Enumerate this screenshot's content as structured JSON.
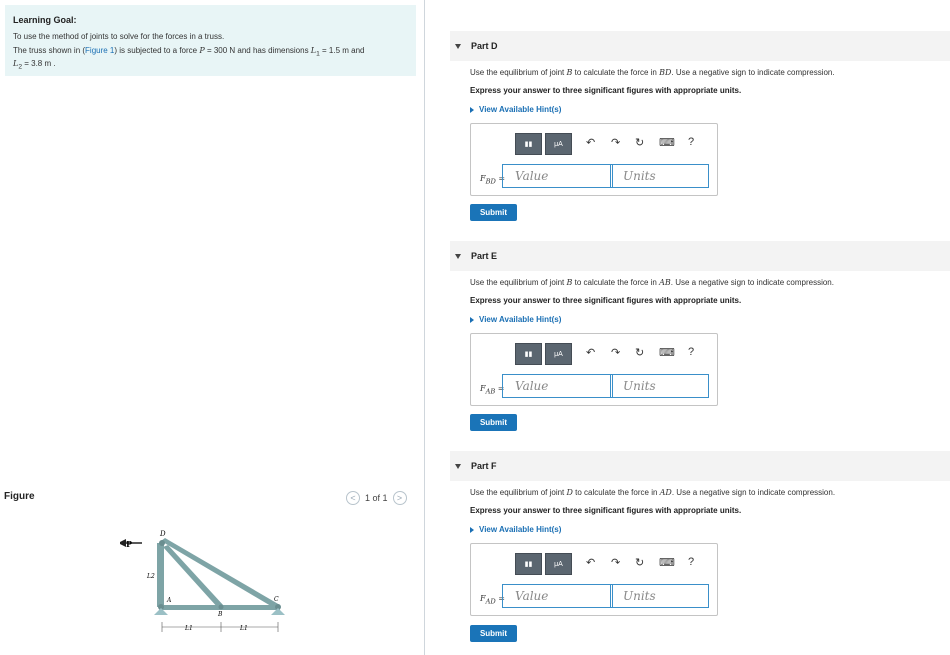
{
  "learning_goal": {
    "title": "Learning Goal:",
    "line1": "To use the method of joints to solve for the forces in a truss.",
    "line2_pre": "The truss shown in (",
    "line2_link": "Figure 1",
    "line2_post": ") is subjected to a force ",
    "p_sym": "P",
    "p_value": " = 300 N",
    "dims_text": " and has dimensions ",
    "l1_sym": "L",
    "l1_sub": "1",
    "l1_value": " = 1.5 m",
    "and_text": " and",
    "l2_sym": "L",
    "l2_sub": "2",
    "l2_value": " = 3.8 m ."
  },
  "figure": {
    "label": "Figure",
    "pager_prev": "<",
    "pager_text": "1 of 1",
    "pager_next": ">",
    "labels": {
      "P": "P",
      "D": "D",
      "A": "A",
      "B": "B",
      "C": "C",
      "L2": "L2",
      "L1a": "L1",
      "L1b": "L1"
    }
  },
  "parts": [
    {
      "title": "Part D",
      "instr_pre": "Use the equilibrium of joint ",
      "instr_joint": "B",
      "instr_mid": " to calculate the force in ",
      "instr_member": "BD",
      "instr_post": ". Use a negative sign to indicate compression.",
      "express": "Express your answer to three significant figures with appropriate units.",
      "hint": "View Available Hint(s)",
      "answer_label": "F",
      "answer_sub": "BD",
      "answer_eq": " =",
      "value_placeholder": "Value",
      "units_placeholder": "Units",
      "submit": "Submit"
    },
    {
      "title": "Part E",
      "instr_pre": "Use the equilibrium of joint ",
      "instr_joint": "B",
      "instr_mid": " to calculate the force in ",
      "instr_member": "AB",
      "instr_post": ". Use a negative sign to indicate compression.",
      "express": "Express your answer to three significant figures with appropriate units.",
      "hint": "View Available Hint(s)",
      "answer_label": "F",
      "answer_sub": "AB",
      "answer_eq": " =",
      "value_placeholder": "Value",
      "units_placeholder": "Units",
      "submit": "Submit"
    },
    {
      "title": "Part F",
      "instr_pre": "Use the equilibrium of joint ",
      "instr_joint": "D",
      "instr_mid": " to calculate the force in ",
      "instr_member": "AD",
      "instr_post": ". Use a negative sign to indicate compression.",
      "express": "Express your answer to three significant figures with appropriate units.",
      "hint": "View Available Hint(s)",
      "answer_label": "F",
      "answer_sub": "AD",
      "answer_eq": " =",
      "value_placeholder": "Value",
      "units_placeholder": "Units",
      "submit": "Submit"
    }
  ],
  "toolbar": {
    "templates_icon": "templates-icon",
    "mu_label": "μA",
    "undo_glyph": "↶",
    "redo_glyph": "↷",
    "reset_glyph": "↻",
    "keyboard_glyph": "⌨",
    "help_glyph": "?"
  }
}
